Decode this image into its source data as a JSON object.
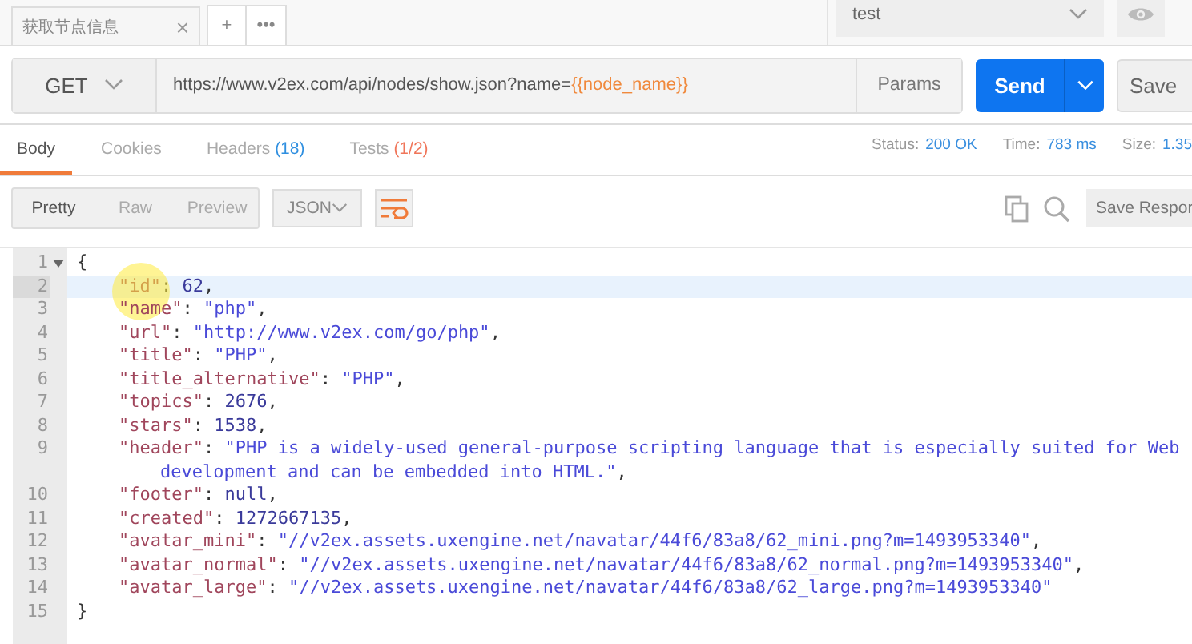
{
  "request_tabs": [
    {
      "label": "获取节点信息",
      "close": "×"
    }
  ],
  "tab_actions": [
    "+",
    "•••"
  ],
  "environment": {
    "value": "test"
  },
  "request": {
    "method": "GET",
    "url": "https://www.v2ex.com/api/nodes/show.json?name=",
    "url_variable": "{{node_name}}",
    "params": "Params",
    "send": "Send",
    "save": "Save"
  },
  "response_tabs": [
    {
      "label": "Body",
      "selected": true
    },
    {
      "label": "Cookies",
      "selected": false
    },
    {
      "label": "Headers",
      "count": "(18)",
      "failing": false,
      "selected": false
    },
    {
      "label": "Tests",
      "count": "(1/2)",
      "failing": true,
      "selected": false
    }
  ],
  "response_meta": [
    {
      "label": "Status:",
      "value": "200 OK"
    },
    {
      "label": "Time:",
      "value": "783 ms"
    },
    {
      "label": "Size:",
      "value": "1.35"
    }
  ],
  "view_modes": [
    {
      "label": "Pretty",
      "selected": true
    },
    {
      "label": "Raw",
      "selected": false
    },
    {
      "label": "Preview",
      "selected": false
    }
  ],
  "format": "JSON",
  "save_response": "Save Respor",
  "code_lines": [
    {
      "number": "1",
      "foldable": true,
      "highlighted": false,
      "tokens": [
        {
          "kind": "punct",
          "text": "{"
        }
      ]
    },
    {
      "number": "2",
      "highlighted": true,
      "indent": true,
      "tokens": [
        {
          "kind": "key",
          "text": "\"id\""
        },
        {
          "kind": "punct",
          "text": ": "
        },
        {
          "kind": "number",
          "text": "62"
        },
        {
          "kind": "punct",
          "text": ","
        }
      ]
    },
    {
      "number": "3",
      "highlighted": false,
      "indent": true,
      "tokens": [
        {
          "kind": "key",
          "text": "\"name\""
        },
        {
          "kind": "punct",
          "text": ": "
        },
        {
          "kind": "string",
          "text": "\"php\""
        },
        {
          "kind": "punct",
          "text": ","
        }
      ]
    },
    {
      "number": "4",
      "highlighted": false,
      "indent": true,
      "tokens": [
        {
          "kind": "key",
          "text": "\"url\""
        },
        {
          "kind": "punct",
          "text": ": "
        },
        {
          "kind": "string",
          "text": "\"http://www.v2ex.com/go/php\""
        },
        {
          "kind": "punct",
          "text": ","
        }
      ]
    },
    {
      "number": "5",
      "highlighted": false,
      "indent": true,
      "tokens": [
        {
          "kind": "key",
          "text": "\"title\""
        },
        {
          "kind": "punct",
          "text": ": "
        },
        {
          "kind": "string",
          "text": "\"PHP\""
        },
        {
          "kind": "punct",
          "text": ","
        }
      ]
    },
    {
      "number": "6",
      "highlighted": false,
      "indent": true,
      "tokens": [
        {
          "kind": "key",
          "text": "\"title_alternative\""
        },
        {
          "kind": "punct",
          "text": ": "
        },
        {
          "kind": "string",
          "text": "\"PHP\""
        },
        {
          "kind": "punct",
          "text": ","
        }
      ]
    },
    {
      "number": "7",
      "highlighted": false,
      "indent": true,
      "tokens": [
        {
          "kind": "key",
          "text": "\"topics\""
        },
        {
          "kind": "punct",
          "text": ": "
        },
        {
          "kind": "number",
          "text": "2676"
        },
        {
          "kind": "punct",
          "text": ","
        }
      ]
    },
    {
      "number": "8",
      "highlighted": false,
      "indent": true,
      "tokens": [
        {
          "kind": "key",
          "text": "\"stars\""
        },
        {
          "kind": "punct",
          "text": ": "
        },
        {
          "kind": "number",
          "text": "1538"
        },
        {
          "kind": "punct",
          "text": ","
        }
      ]
    },
    {
      "number": "9",
      "highlighted": false,
      "indent": true,
      "tokens": [
        {
          "kind": "key",
          "text": "\"header\""
        },
        {
          "kind": "punct",
          "text": ": "
        },
        {
          "kind": "string",
          "text": "\"PHP is a widely-used general-purpose scripting language that is especially suited for Web"
        }
      ],
      "continuation": [
        {
          "kind": "string",
          "text": "development and can be embedded into HTML.\""
        },
        {
          "kind": "punct",
          "text": ","
        }
      ]
    },
    {
      "number": "10",
      "highlighted": false,
      "indent": true,
      "tokens": [
        {
          "kind": "key",
          "text": "\"footer\""
        },
        {
          "kind": "punct",
          "text": ": "
        },
        {
          "kind": "number",
          "text": "null"
        },
        {
          "kind": "punct",
          "text": ","
        }
      ]
    },
    {
      "number": "11",
      "highlighted": false,
      "indent": true,
      "tokens": [
        {
          "kind": "key",
          "text": "\"created\""
        },
        {
          "kind": "punct",
          "text": ": "
        },
        {
          "kind": "number",
          "text": "1272667135"
        },
        {
          "kind": "punct",
          "text": ","
        }
      ]
    },
    {
      "number": "12",
      "highlighted": false,
      "indent": true,
      "tokens": [
        {
          "kind": "key",
          "text": "\"avatar_mini\""
        },
        {
          "kind": "punct",
          "text": ": "
        },
        {
          "kind": "string",
          "text": "\"//v2ex.assets.uxengine.net/navatar/44f6/83a8/62_mini.png?m=1493953340\""
        },
        {
          "kind": "punct",
          "text": ","
        }
      ]
    },
    {
      "number": "13",
      "highlighted": false,
      "indent": true,
      "tokens": [
        {
          "kind": "key",
          "text": "\"avatar_normal\""
        },
        {
          "kind": "punct",
          "text": ": "
        },
        {
          "kind": "string",
          "text": "\"//v2ex.assets.uxengine.net/navatar/44f6/83a8/62_normal.png?m=1493953340\""
        },
        {
          "kind": "punct",
          "text": ","
        }
      ]
    },
    {
      "number": "14",
      "highlighted": false,
      "indent": true,
      "tokens": [
        {
          "kind": "key",
          "text": "\"avatar_large\""
        },
        {
          "kind": "punct",
          "text": ": "
        },
        {
          "kind": "string",
          "text": "\"//v2ex.assets.uxengine.net/navatar/44f6/83a8/62_large.png?m=1493953340\""
        }
      ]
    },
    {
      "number": "15",
      "highlighted": false,
      "tokens": [
        {
          "kind": "punct",
          "text": "}"
        }
      ]
    }
  ]
}
